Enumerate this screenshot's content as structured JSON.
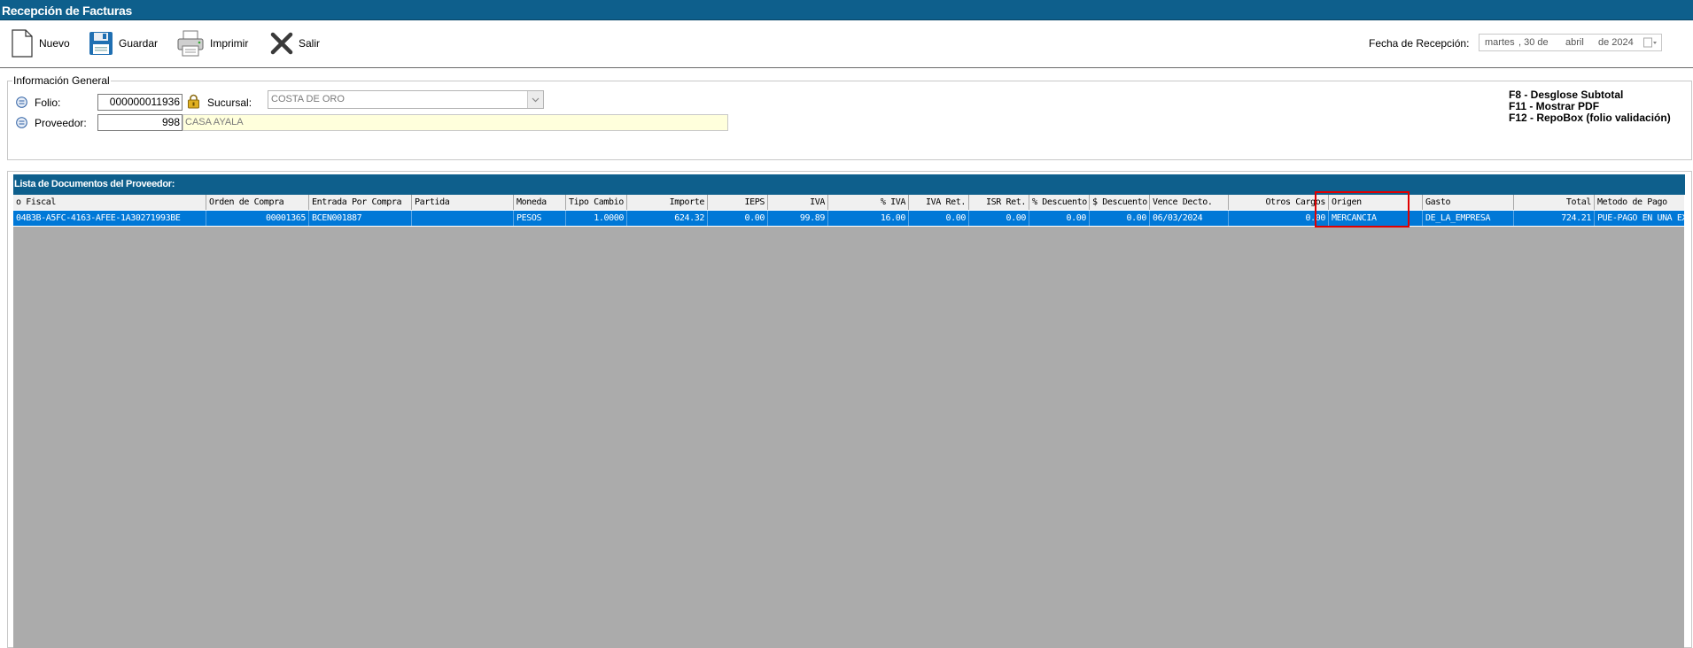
{
  "window": {
    "title": "Recepción de Facturas"
  },
  "toolbar": {
    "nuevo": "Nuevo",
    "guardar": "Guardar",
    "imprimir": "Imprimir",
    "salir": "Salir"
  },
  "fecha": {
    "label": "Fecha de Recepción:",
    "weekday": "martes",
    "day": ", 30 de",
    "month": "abril",
    "year": "de 2024"
  },
  "general": {
    "legend": "Información General",
    "folio_label": "Folio:",
    "folio_value": "000000011936",
    "sucursal_label": "Sucursal:",
    "sucursal_value": "COSTA DE ORO",
    "proveedor_label": "Proveedor:",
    "proveedor_id": "998",
    "proveedor_name": "CASA AYALA"
  },
  "shortcuts": [
    "F8  - Desglose Subtotal",
    "F11 - Mostrar PDF",
    "F12 - RepoBox (folio validación)"
  ],
  "list": {
    "title": "Lista de Documentos del Proveedor:",
    "columns": [
      "o Fiscal",
      "Orden de Compra",
      "Entrada Por Compra",
      "Partida",
      "Moneda",
      "Tipo Cambio",
      "Importe",
      "IEPS",
      "IVA",
      "% IVA",
      "IVA Ret.",
      "ISR Ret.",
      "% Descuento",
      "$ Descuento",
      "Vence Decto.",
      "Otros Cargos",
      "Origen",
      "Gasto",
      "Total",
      "Metodo de Pago"
    ],
    "rows": [
      [
        "04B3B-A5FC-4163-AFEE-1A30271993BE",
        "00001365",
        "BCEN001887",
        "",
        "PESOS",
        "1.0000",
        "624.32",
        "0.00",
        "99.89",
        "16.00",
        "0.00",
        "0.00",
        "0.00",
        "0.00",
        "06/03/2024",
        "0.00",
        "MERCANCIA",
        "DE_LA_EMPRESA",
        "724.21",
        "PUE-PAGO EN UNA EXH"
      ]
    ]
  },
  "colors": {
    "title_bar": "#0e5f8c",
    "selected_row": "#0078d7",
    "grid_empty": "#ababab",
    "highlight_box": "#e00000"
  }
}
